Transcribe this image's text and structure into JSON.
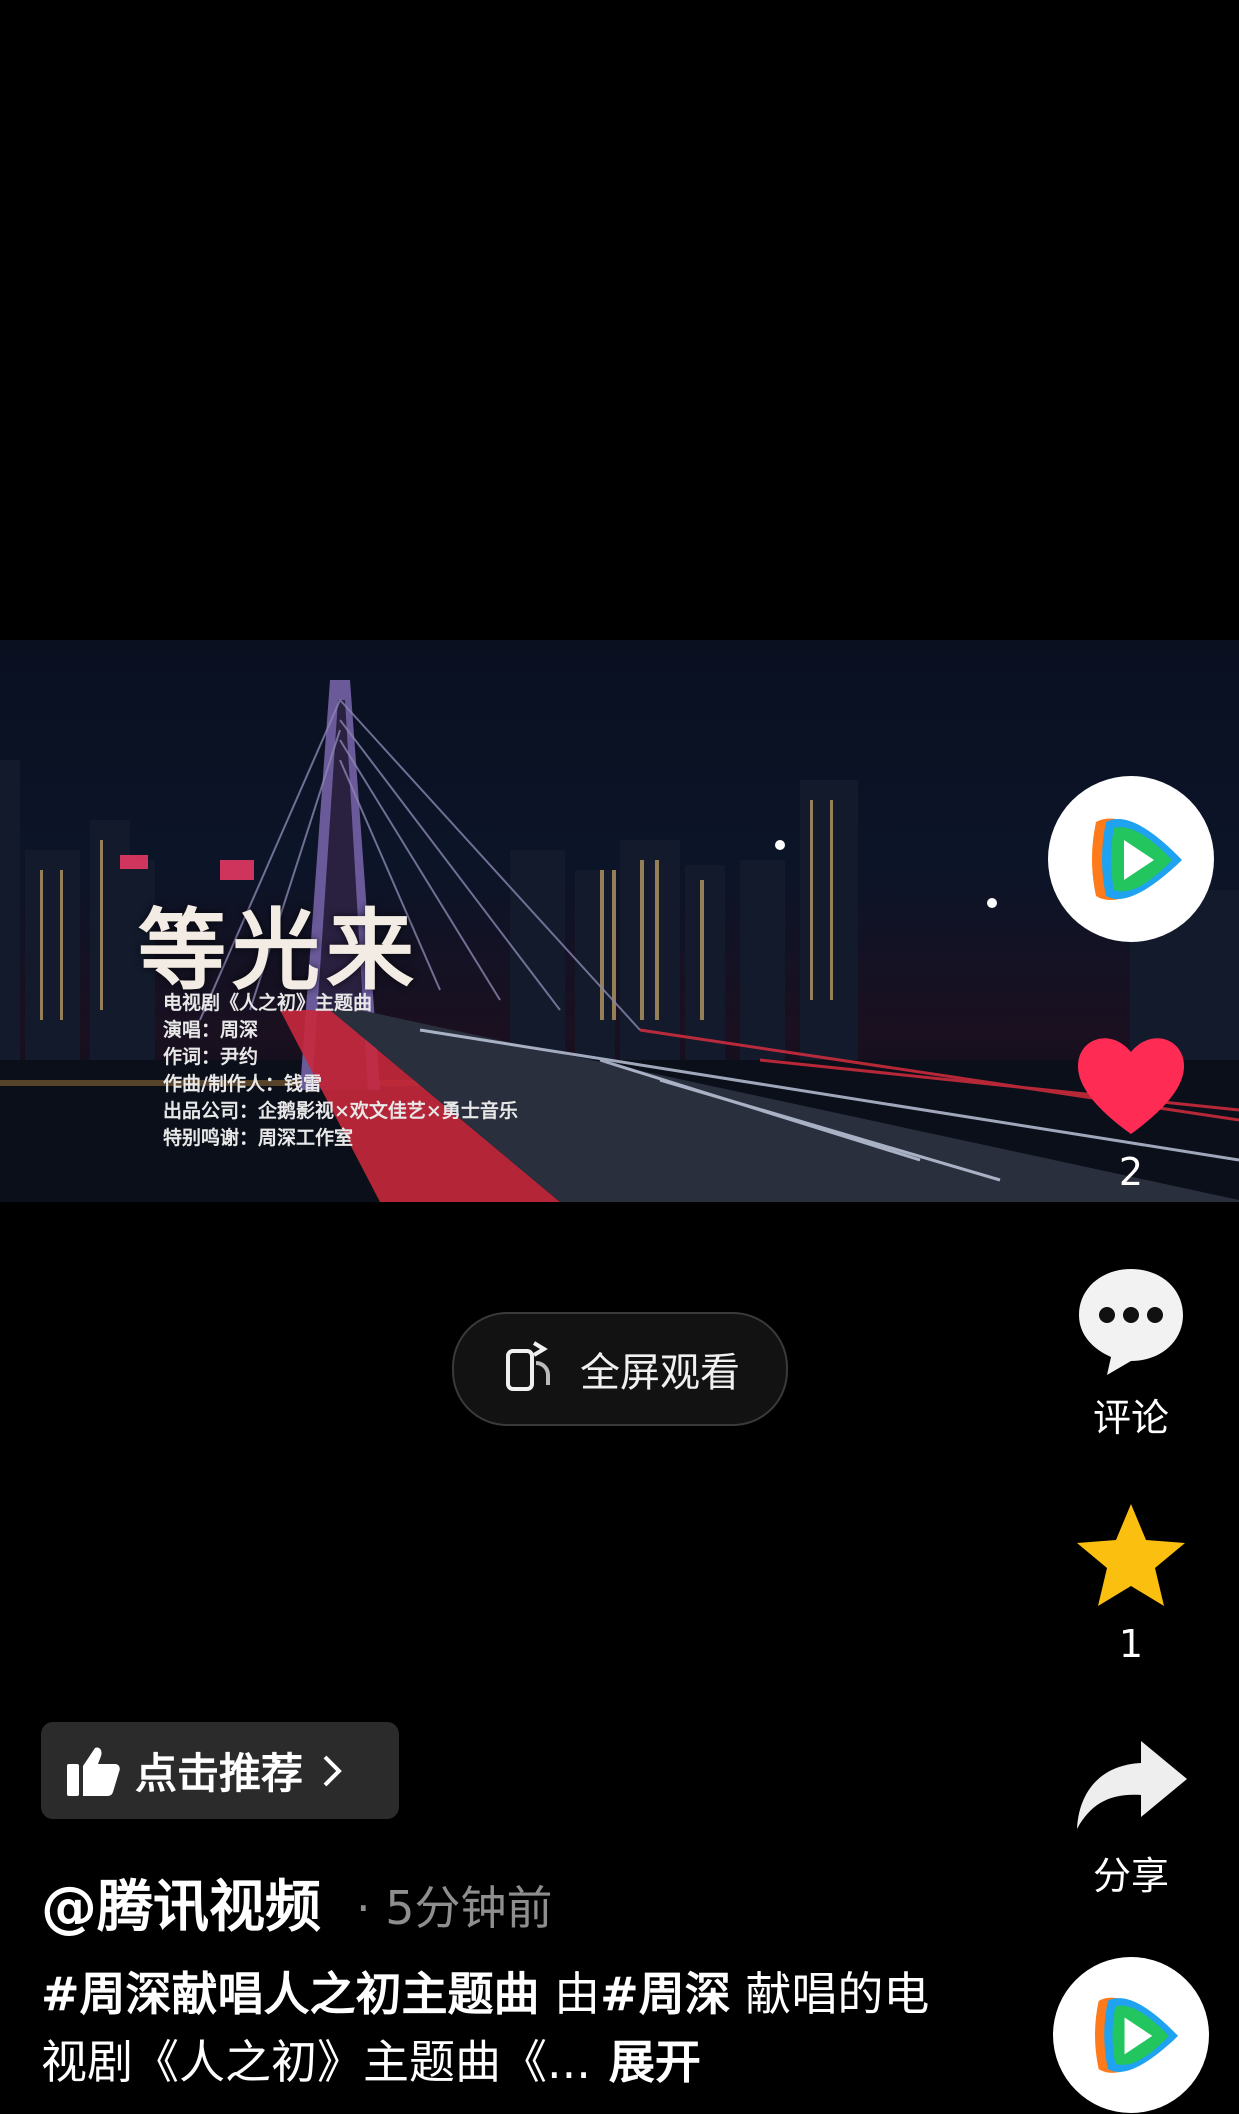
{
  "video": {
    "title": "等光来",
    "credits": [
      "电视剧《人之初》主题曲",
      "演唱：周深",
      "作词：尹约",
      "作曲/制作人：钱雷",
      "出品公司：企鹅影视×欢文佳艺×勇士音乐",
      "特别鸣谢：周深工作室"
    ]
  },
  "fullscreen_button": {
    "label": "全屏观看"
  },
  "actions": {
    "like_count": "2",
    "comment_label": "评论",
    "favorite_count": "1",
    "share_label": "分享"
  },
  "recommend": {
    "label": "点击推荐"
  },
  "post": {
    "author": "@腾讯视频",
    "time": "· 5分钟前",
    "desc_tag1": "#周深献唱人之初主题曲",
    "desc_text1": " 由",
    "desc_tag2": "#周深",
    "desc_text2": " 献唱的电视剧《人之初》主题曲《...",
    "more": "展开"
  },
  "colors": {
    "like": "#fe2c55",
    "star": "#fbbf0f",
    "tencent_blue": "#1fa3f0",
    "tencent_green": "#22c55e",
    "tencent_orange": "#ff7a1a"
  }
}
